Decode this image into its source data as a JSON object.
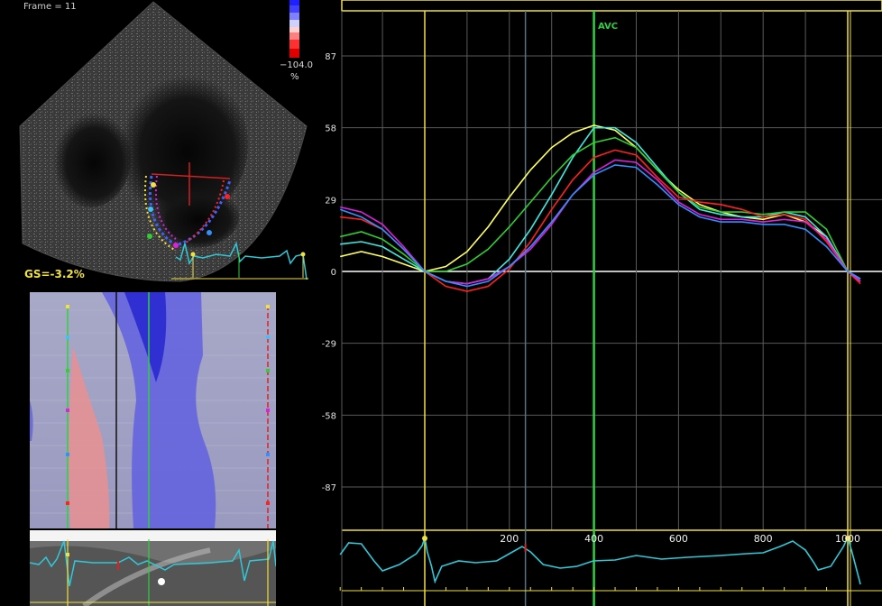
{
  "viewer": {
    "frame_label": "Frame = 11",
    "global_strain": "GS=-3.2%",
    "color_scale": {
      "min_label": "−104.0",
      "unit": "%"
    },
    "marker_label": "AVC"
  },
  "colors": {
    "background": "#000000",
    "grid": "#5a5a5a",
    "zero_line": "#ffffff",
    "marker_yellow": "#f0e040",
    "marker_green": "#30d040",
    "ecg": "#30c8d8"
  },
  "chart_data": {
    "type": "line",
    "title": "",
    "xlabel": "",
    "ylabel": "",
    "xlim": [
      -200,
      1030
    ],
    "ylim": [
      -104,
      104
    ],
    "x_ticks": [
      200,
      400,
      600,
      800,
      1000
    ],
    "y_ticks": [
      87,
      58,
      29,
      0,
      -29,
      -58,
      -87
    ],
    "grid": true,
    "markers": [
      {
        "x": 0,
        "color": "#f0e040"
      },
      {
        "x": 238,
        "color": "#5a7080"
      },
      {
        "x": 400,
        "color": "#30d040",
        "label": "AVC"
      },
      {
        "x": 1000,
        "color": "#f0e040"
      }
    ],
    "series": [
      {
        "color": "#ffff60",
        "x": [
          -200,
          -150,
          -100,
          -50,
          0,
          50,
          100,
          150,
          200,
          250,
          300,
          350,
          400,
          450,
          500,
          550,
          600,
          650,
          700,
          750,
          800,
          850,
          900,
          950,
          1000,
          1030
        ],
        "y": [
          6,
          8,
          6,
          3,
          0,
          2,
          8,
          18,
          30,
          41,
          50,
          56,
          59,
          57,
          50,
          41,
          33,
          27,
          24,
          22,
          21,
          23,
          20,
          14,
          0,
          -4
        ]
      },
      {
        "color": "#40e8e0",
        "x": [
          -200,
          -150,
          -100,
          -50,
          0,
          50,
          100,
          150,
          200,
          250,
          300,
          350,
          400,
          450,
          500,
          550,
          600,
          650,
          700,
          750,
          800,
          850,
          900,
          950,
          1000,
          1030
        ],
        "y": [
          11,
          12,
          10,
          5,
          0,
          -4,
          -5,
          -3,
          5,
          17,
          31,
          46,
          58,
          58,
          52,
          42,
          32,
          25,
          23,
          22,
          22,
          24,
          22,
          14,
          0,
          -3
        ]
      },
      {
        "color": "#30d030",
        "x": [
          -200,
          -150,
          -100,
          -50,
          0,
          50,
          100,
          150,
          200,
          250,
          300,
          350,
          400,
          450,
          500,
          550,
          600,
          650,
          700,
          750,
          800,
          850,
          900,
          950,
          1000,
          1030
        ],
        "y": [
          14,
          16,
          13,
          7,
          0,
          0,
          3,
          9,
          18,
          28,
          38,
          47,
          52,
          54,
          50,
          41,
          32,
          26,
          24,
          24,
          23,
          24,
          24,
          17,
          0,
          -4
        ]
      },
      {
        "color": "#ff2020",
        "x": [
          -200,
          -150,
          -100,
          -50,
          0,
          50,
          100,
          150,
          200,
          250,
          300,
          350,
          400,
          450,
          500,
          550,
          600,
          650,
          700,
          750,
          800,
          850,
          900,
          950,
          1000,
          1030
        ],
        "y": [
          22,
          21,
          17,
          9,
          0,
          -6,
          -8,
          -6,
          1,
          12,
          25,
          37,
          46,
          49,
          47,
          38,
          30,
          28,
          27,
          25,
          22,
          23,
          21,
          12,
          0,
          -5
        ]
      },
      {
        "color": "#e020e0",
        "x": [
          -200,
          -150,
          -100,
          -50,
          0,
          50,
          100,
          150,
          200,
          250,
          300,
          350,
          400,
          450,
          500,
          550,
          600,
          650,
          700,
          750,
          800,
          850,
          900,
          950,
          1000,
          1030
        ],
        "y": [
          26,
          24,
          19,
          10,
          0,
          -4,
          -5,
          -3,
          2,
          9,
          19,
          31,
          40,
          45,
          44,
          37,
          28,
          23,
          21,
          21,
          20,
          21,
          20,
          13,
          0,
          -4
        ]
      },
      {
        "color": "#3090ff",
        "x": [
          -200,
          -150,
          -100,
          -50,
          0,
          50,
          100,
          150,
          200,
          250,
          300,
          350,
          400,
          450,
          500,
          550,
          600,
          650,
          700,
          750,
          800,
          850,
          900,
          950,
          1000,
          1030
        ],
        "y": [
          25,
          22,
          17,
          9,
          0,
          -4,
          -6,
          -4,
          2,
          10,
          20,
          31,
          39,
          43,
          42,
          35,
          27,
          22,
          20,
          20,
          19,
          19,
          17,
          10,
          0,
          -3
        ]
      }
    ],
    "ecg_x_ticks": [
      0,
      200,
      400,
      600,
      800,
      1000
    ]
  }
}
